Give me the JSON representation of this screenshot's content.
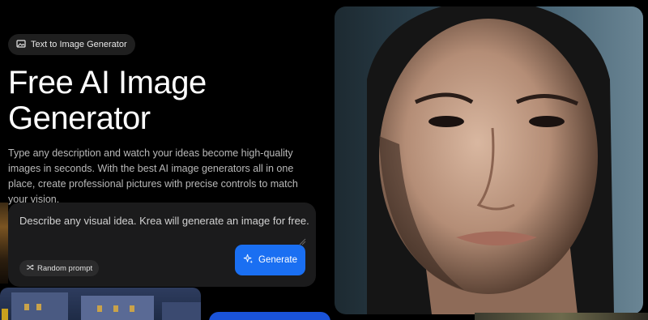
{
  "badge": {
    "icon": "image-icon",
    "label": "Text to Image Generator"
  },
  "hero": {
    "title": "Free AI Image Generator",
    "description": "Type any description and watch your ideas become high-quality images in seconds. With the best AI image generators all in one place, create professional pictures with precise controls to match your vision."
  },
  "prompt": {
    "placeholder": "Describe any visual idea. Krea will generate an image for free.",
    "random_button_label": "Random prompt",
    "random_icon": "shuffle-icon",
    "generate_button_label": "Generate",
    "generate_icon": "sparkles-icon"
  },
  "colors": {
    "background": "#000000",
    "prompt_box": "#1b1b1c",
    "accent": "#1a6ff2"
  }
}
